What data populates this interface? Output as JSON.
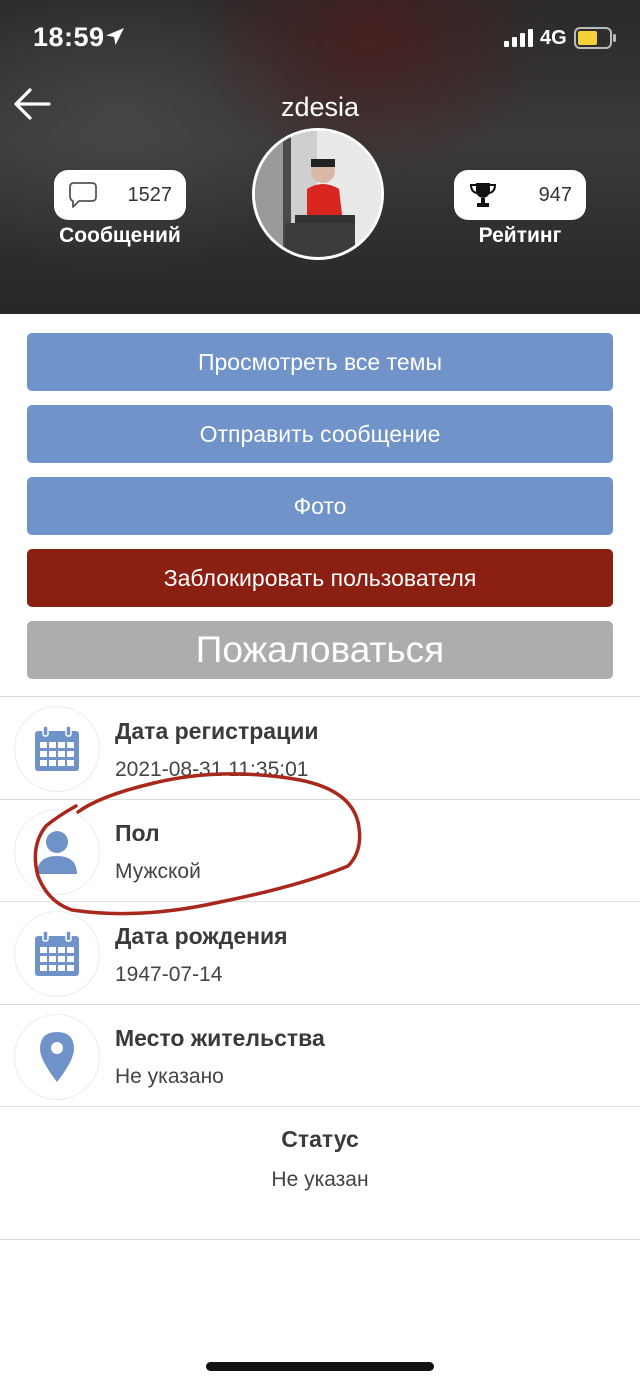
{
  "status_bar": {
    "time": "18:59",
    "network": "4G"
  },
  "profile": {
    "username": "zdesia",
    "messages_count": "1527",
    "messages_label": "Сообщений",
    "rating_value": "947",
    "rating_label": "Рейтинг"
  },
  "actions": {
    "view_topics": "Просмотреть все темы",
    "send_message": "Отправить сообщение",
    "photo": "Фото",
    "block_user": "Заблокировать пользователя",
    "report": "Пожаловаться"
  },
  "info": [
    {
      "title": "Дата регистрации",
      "value": "2021-08-31 11:35:01",
      "icon": "calendar-icon"
    },
    {
      "title": "Пол",
      "value": "Мужской",
      "icon": "person-icon"
    },
    {
      "title": "Дата рождения",
      "value": "1947-07-14",
      "icon": "calendar-icon"
    },
    {
      "title": "Место жительства",
      "value": "Не указано",
      "icon": "location-pin-icon"
    }
  ],
  "status": {
    "title": "Статус",
    "value": "Не указан"
  },
  "colors": {
    "button_blue": "#7093c9",
    "button_red": "#8a1f12",
    "button_gray": "#adadad",
    "icon_blue": "#6f93c9",
    "annotation_red": "#a8281c"
  }
}
